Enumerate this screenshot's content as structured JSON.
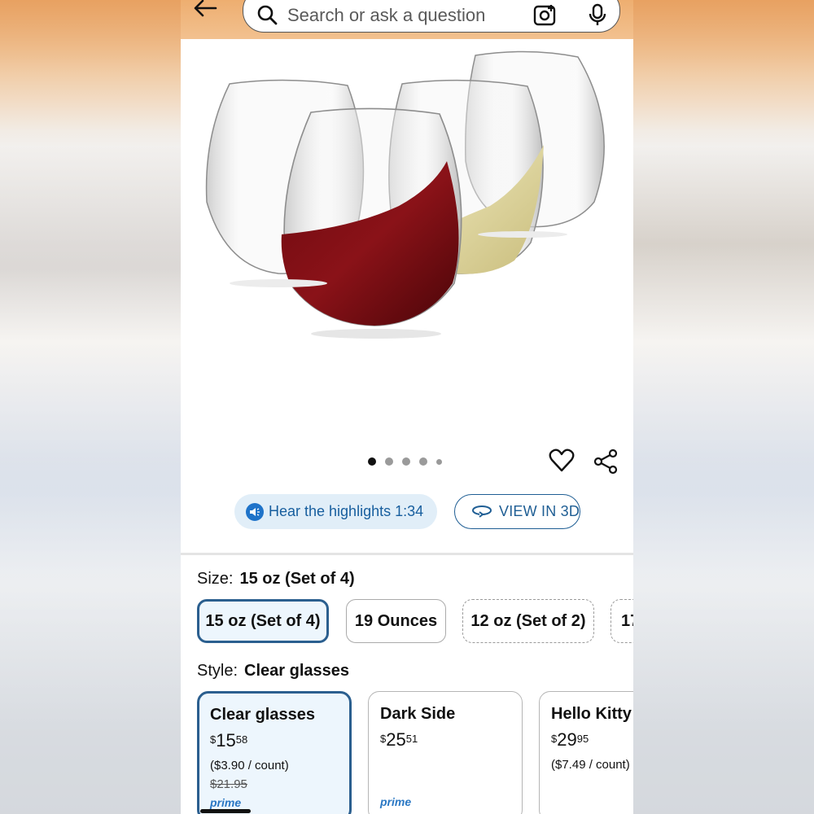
{
  "search": {
    "placeholder": "Search or ask a question"
  },
  "gallery": {
    "image_alt": "Four stemless wine glasses, two filled with red and white wine",
    "total_images": 5,
    "active_index": 0
  },
  "actions": {
    "hear_highlights": "Hear the highlights 1:34",
    "view_3d": "VIEW IN 3D"
  },
  "size": {
    "label": "Size:",
    "selected": "15 oz (Set of 4)",
    "options": [
      "15 oz (Set of 4)",
      "19 Ounces",
      "12 oz (Set of 2)",
      "17"
    ]
  },
  "style": {
    "label": "Style:",
    "selected": "Clear glasses",
    "options": [
      {
        "name": "Clear glasses",
        "currency": "$",
        "whole": "15",
        "fraction": "58",
        "unit_price": "($3.90 / count)",
        "list_price": "$21.95",
        "badge": "prime"
      },
      {
        "name": "Dark Side",
        "currency": "$",
        "whole": "25",
        "fraction": "51",
        "unit_price": "",
        "list_price": "",
        "badge": "prime"
      },
      {
        "name": "Hello Kitty",
        "currency": "$",
        "whole": "29",
        "fraction": "95",
        "unit_price": "($7.49 / count)",
        "list_price": "",
        "badge": ""
      }
    ]
  },
  "colors": {
    "accent": "#2b5f8f",
    "link": "#1f5e94",
    "header": "#eeae70"
  }
}
